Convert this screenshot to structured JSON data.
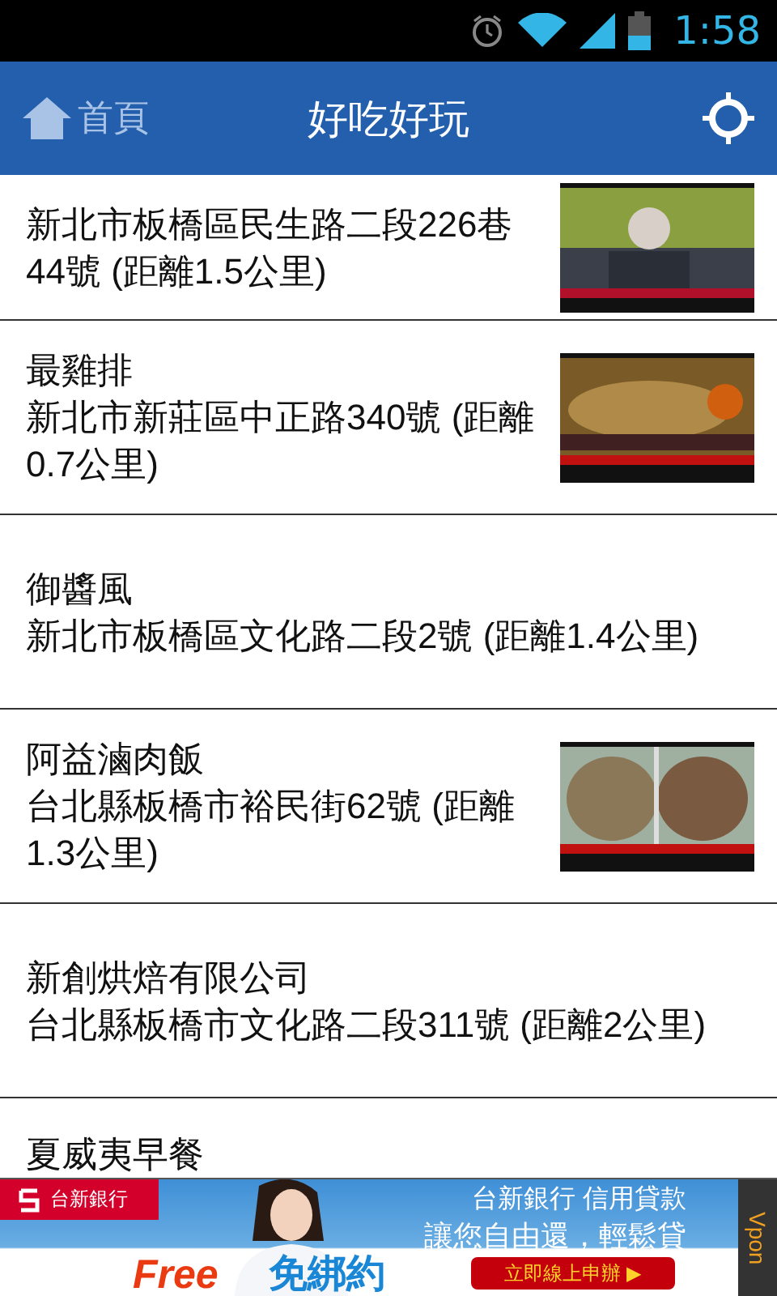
{
  "status_bar": {
    "time": "1:58"
  },
  "header": {
    "back_label": "首頁",
    "title": "好吃好玩"
  },
  "places": [
    {
      "address": "新北市板橋區民生路二段226巷44號 (距離1.5公里)"
    },
    {
      "name": "最雞排",
      "address": "新北市新莊區中正路340號 (距離0.7公里)"
    },
    {
      "name": "御醬風",
      "address": "新北市板橋區文化路二段2號 (距離1.4公里)"
    },
    {
      "name": "阿益滷肉飯",
      "address": "台北縣板橋市裕民街62號 (距離1.3公里)"
    },
    {
      "name": "新創烘焙有限公司",
      "address": "台北縣板橋市文化路二段311號 (距離2公里)"
    },
    {
      "name": "夏威夷早餐"
    }
  ],
  "ad": {
    "brand": "台新銀行",
    "headline": "台新銀行 信用貸款",
    "tagline": "讓您自由還，輕鬆貸",
    "free": "Free",
    "offer": "免綁約",
    "cta": "立即線上申辦 ▶",
    "network": "Vpon"
  }
}
